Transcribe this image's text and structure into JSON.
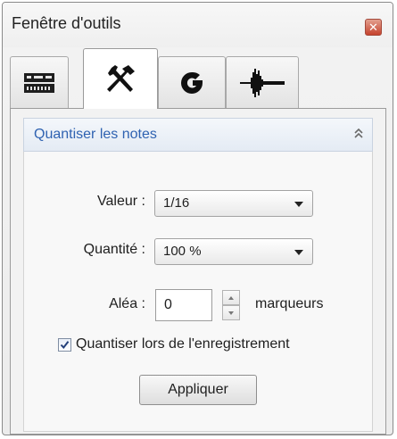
{
  "window": {
    "title": "Fenêtre d'outils",
    "close_glyph": "✕"
  },
  "tabs": [
    {
      "icon": "mixer-icon",
      "selected": false
    },
    {
      "icon": "tools-icon",
      "selected": true
    },
    {
      "icon": "groove-icon",
      "selected": false
    },
    {
      "icon": "waveform-icon",
      "selected": false
    }
  ],
  "section": {
    "title": "Quantiser les notes",
    "collapse_icon": "double-chevron-up-icon"
  },
  "form": {
    "valeur": {
      "label": "Valeur :",
      "value": "1/16"
    },
    "quantite": {
      "label": "Quantité :",
      "value": "100 %"
    },
    "alea": {
      "label": "Aléa :",
      "value": "0",
      "unit": "marqueurs"
    },
    "quantize_while_recording": {
      "label": "Quantiser lors de l'enregistrement",
      "checked": true
    },
    "apply_label": "Appliquer"
  },
  "colors": {
    "section_title": "#2f62b1",
    "close_button": "#c5422d",
    "panel_background": "#f2f2f2"
  }
}
